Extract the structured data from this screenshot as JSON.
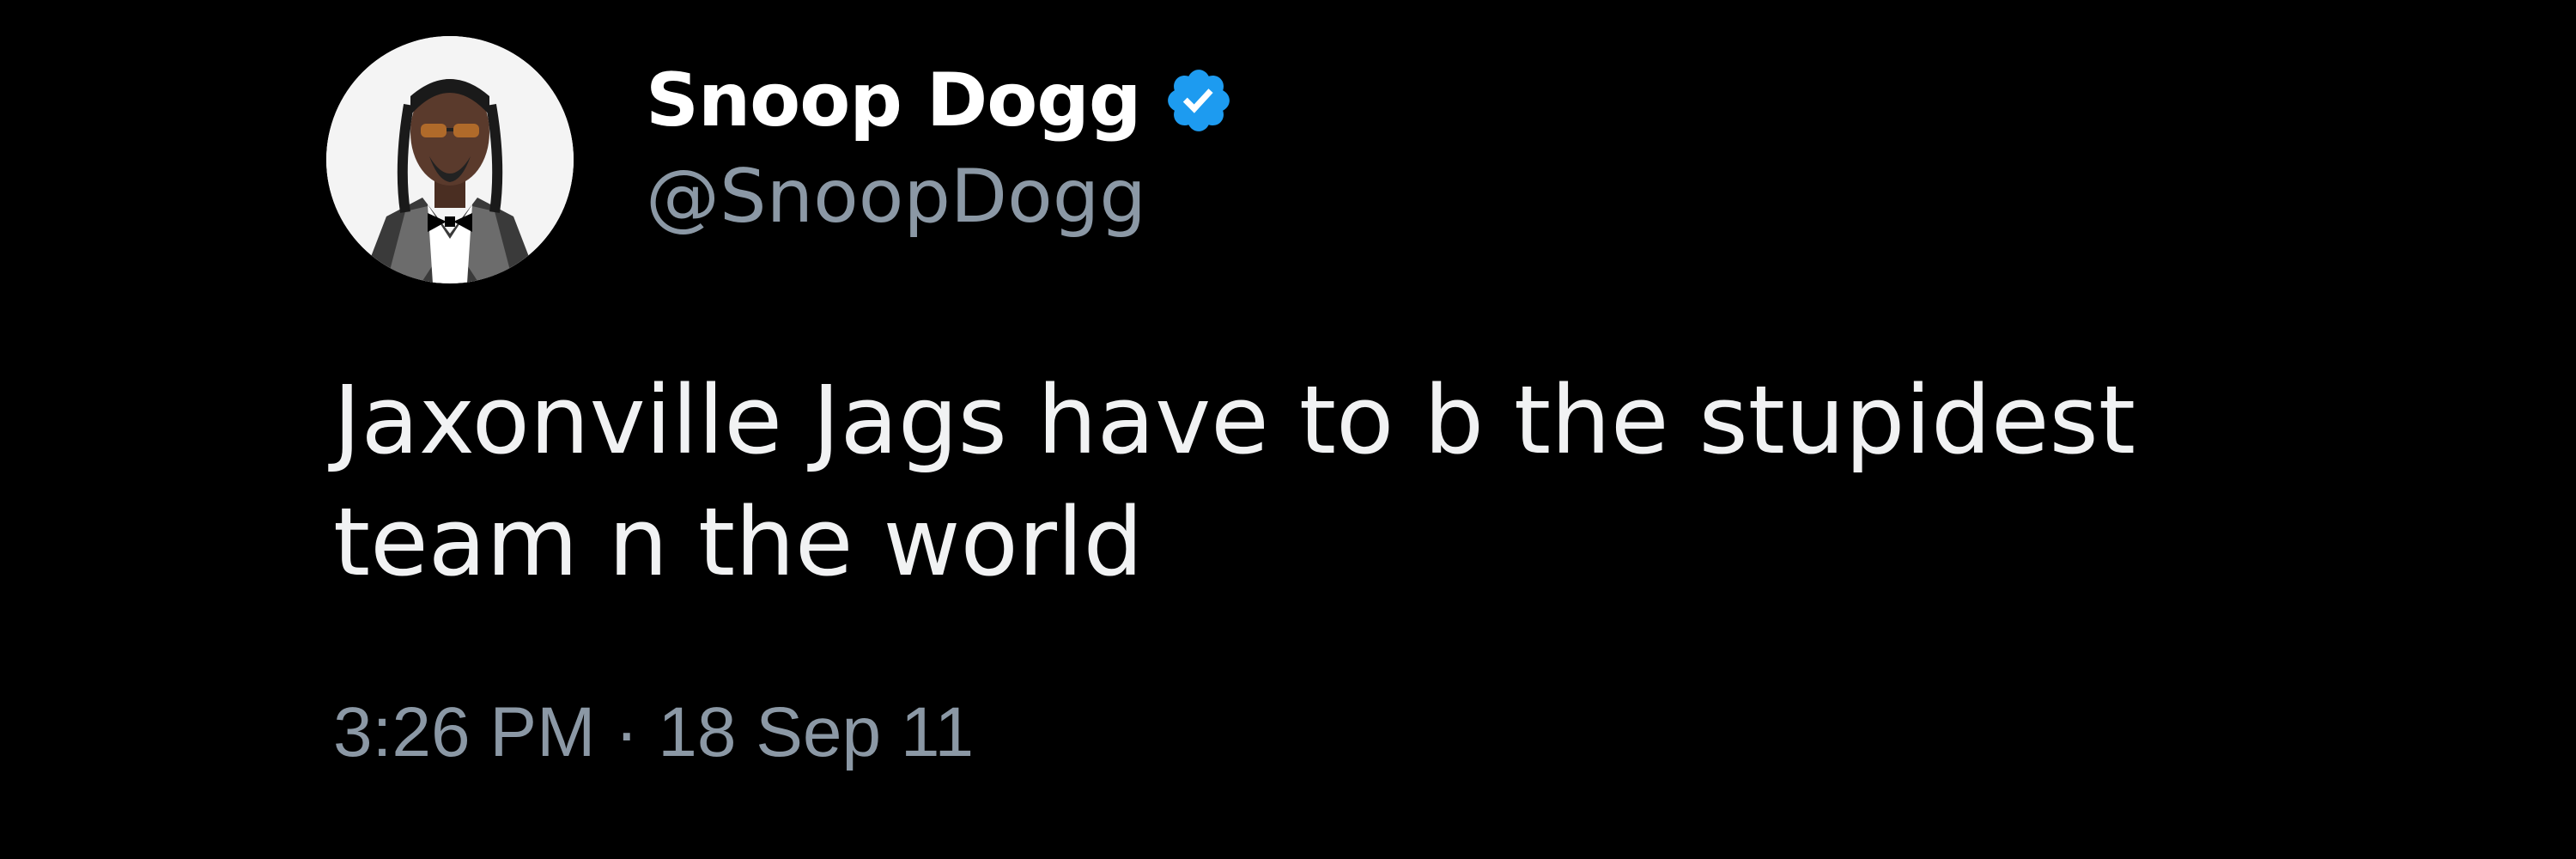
{
  "author": {
    "display_name": "Snoop Dogg",
    "handle": "@SnoopDogg",
    "verified": true
  },
  "tweet": {
    "text": "Jaxonville Jags have to b the stupidest team n the world",
    "timestamp": "3:26 PM · 18 Sep 11"
  },
  "colors": {
    "background": "#000000",
    "verified_badge": "#1d9bf0",
    "secondary_text": "#8b98a5"
  },
  "icons": {
    "verified": "verified-badge-icon"
  }
}
